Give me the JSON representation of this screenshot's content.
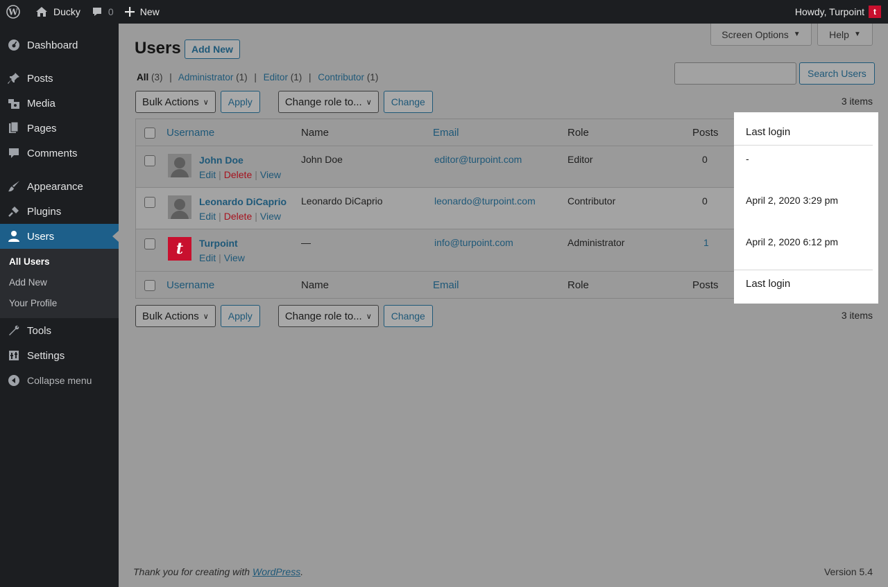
{
  "adminbar": {
    "site_name": "Ducky",
    "comments_count": "0",
    "new_label": "New",
    "howdy": "Howdy, Turpoint"
  },
  "sidebar": {
    "items": [
      {
        "label": "Dashboard",
        "icon": "dashboard-icon"
      },
      {
        "label": "Posts",
        "icon": "pin-icon"
      },
      {
        "label": "Media",
        "icon": "media-icon"
      },
      {
        "label": "Pages",
        "icon": "pages-icon"
      },
      {
        "label": "Comments",
        "icon": "comment-icon"
      },
      {
        "label": "Appearance",
        "icon": "brush-icon"
      },
      {
        "label": "Plugins",
        "icon": "plug-icon"
      },
      {
        "label": "Users",
        "icon": "user-icon",
        "active": true
      },
      {
        "label": "Tools",
        "icon": "wrench-icon"
      },
      {
        "label": "Settings",
        "icon": "settings-icon"
      },
      {
        "label": "Collapse menu",
        "icon": "collapse-icon"
      }
    ],
    "submenu": [
      "All Users",
      "Add New",
      "Your Profile"
    ]
  },
  "header": {
    "screen_options": "Screen Options",
    "help": "Help",
    "title": "Users",
    "add_new": "Add New"
  },
  "views": {
    "all": "All",
    "all_count": "(3)",
    "administrator": "Administrator",
    "administrator_count": "(1)",
    "editor": "Editor",
    "editor_count": "(1)",
    "contributor": "Contributor",
    "contributor_count": "(1)"
  },
  "search": {
    "value": "",
    "button": "Search Users"
  },
  "tablenav": {
    "bulk_actions": "Bulk Actions",
    "apply": "Apply",
    "change_role": "Change role to...",
    "change": "Change",
    "items": "3 items"
  },
  "table": {
    "columns": [
      "Username",
      "Name",
      "Email",
      "Role",
      "Posts",
      "Last login"
    ],
    "rows": [
      {
        "username": "John Doe",
        "name": "John Doe",
        "email": "editor@turpoint.com",
        "role": "Editor",
        "posts": "0",
        "last_login": "-",
        "actions": [
          "Edit",
          "Delete",
          "View"
        ],
        "avatar": "default"
      },
      {
        "username": "Leonardo DiCaprio",
        "name": "Leonardo DiCaprio",
        "email": "leonardo@turpoint.com",
        "role": "Contributor",
        "posts": "0",
        "last_login": "April 2, 2020 3:29 pm",
        "actions": [
          "Edit",
          "Delete",
          "View"
        ],
        "avatar": "default"
      },
      {
        "username": "Turpoint",
        "name": "—",
        "email": "info@turpoint.com",
        "role": "Administrator",
        "posts": "1",
        "last_login": "April 2, 2020 6:12 pm",
        "actions": [
          "Edit",
          "View"
        ],
        "avatar": "brand"
      }
    ]
  },
  "footer": {
    "thanks_prefix": "Thank you for creating with",
    "wordpress_link": "WordPress",
    "thanks_suffix": ".",
    "version": "Version 5.4"
  },
  "colors": {
    "link": "#1e5878",
    "delete": "#a5121e",
    "active_menu": "#1d5f8a",
    "brand": "#c8102e"
  }
}
